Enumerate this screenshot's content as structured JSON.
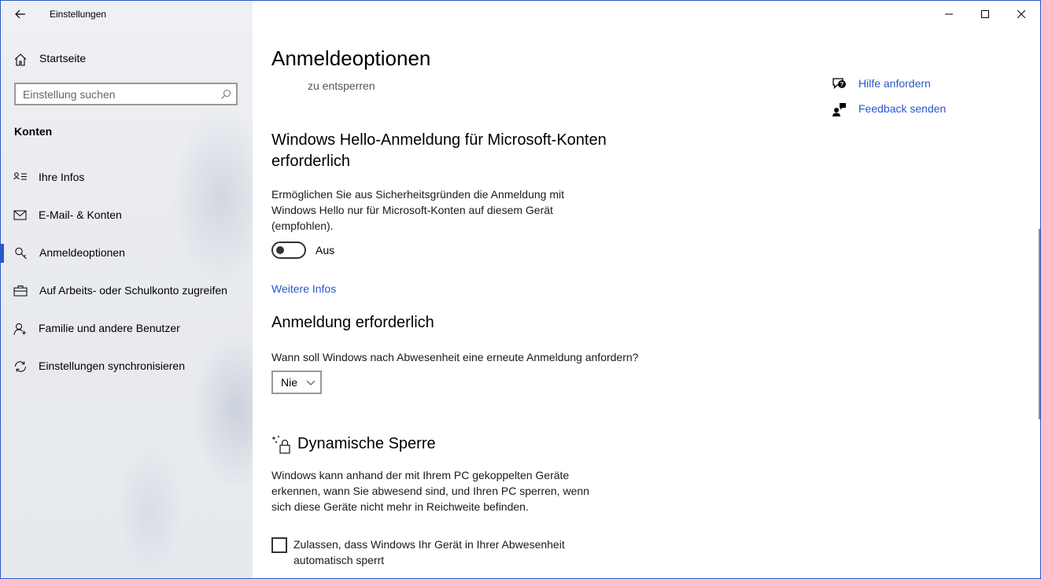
{
  "window": {
    "app_title": "Einstellungen",
    "controls": {
      "minimize": "minimize-icon",
      "maximize": "maximize-icon",
      "close": "close-icon"
    }
  },
  "sidebar": {
    "home_label": "Startseite",
    "search_placeholder": "Einstellung suchen",
    "section_label": "Konten",
    "items": [
      {
        "label": "Ihre Infos",
        "icon": "contact-card-icon",
        "active": false
      },
      {
        "label": "E-Mail- & Konten",
        "icon": "mail-icon",
        "active": false
      },
      {
        "label": "Anmeldeoptionen",
        "icon": "key-icon",
        "active": true
      },
      {
        "label": "Auf Arbeits- oder Schulkonto zugreifen",
        "icon": "briefcase-icon",
        "active": false
      },
      {
        "label": "Familie und andere Benutzer",
        "icon": "add-user-icon",
        "active": false
      },
      {
        "label": "Einstellungen synchronisieren",
        "icon": "sync-icon",
        "active": false
      }
    ],
    "accent_color": "#2b57c9"
  },
  "main": {
    "page_title": "Anmeldeoptionen",
    "cut_off_text": "zu entsperren",
    "hello_section": {
      "heading": "Windows Hello-Anmeldung für Microsoft-Konten erforderlich",
      "description": "Ermöglichen Sie aus Sicherheitsgründen die Anmeldung mit Windows Hello nur für Microsoft-Konten auf diesem Gerät (empfohlen).",
      "toggle_state_label": "Aus",
      "toggle_on": false,
      "more_info_link": "Weitere Infos"
    },
    "signin_section": {
      "heading": "Anmeldung erforderlich",
      "question": "Wann soll Windows nach Abwesenheit eine erneute Anmeldung anfordern?",
      "selected_value": "Nie"
    },
    "dynamic_lock_section": {
      "heading": "Dynamische Sperre",
      "description": "Windows kann anhand der mit Ihrem PC gekoppelten Geräte erkennen, wann Sie abwesend sind, und Ihren PC sperren, wenn sich diese Geräte nicht mehr in Reichweite befinden.",
      "checkbox_label": "Zulassen, dass Windows Ihr Gerät in Ihrer Abwesenheit automatisch sperrt",
      "checkbox_checked": false
    },
    "help": {
      "get_help": "Hilfe anfordern",
      "send_feedback": "Feedback senden"
    },
    "link_color": "#2b57c9"
  }
}
